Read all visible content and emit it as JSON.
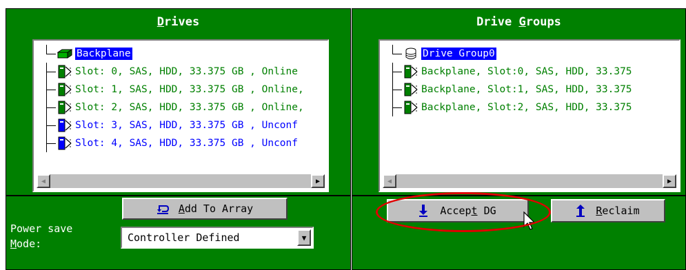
{
  "drives": {
    "title_pre": "",
    "title_u": "D",
    "title_post": "rives",
    "root": "Backplane",
    "items": [
      {
        "label": "Slot: 0, SAS, HDD, 33.375 GB , Online",
        "state": "online"
      },
      {
        "label": "Slot: 1, SAS, HDD, 33.375 GB , Online,",
        "state": "online"
      },
      {
        "label": "Slot: 2, SAS, HDD, 33.375 GB , Online,",
        "state": "online"
      },
      {
        "label": "Slot: 3, SAS, HDD, 33.375 GB , Unconf",
        "state": "unconf"
      },
      {
        "label": "Slot: 4, SAS, HDD, 33.375 GB , Unconf",
        "state": "unconf"
      }
    ],
    "add_pre": "",
    "add_u": "A",
    "add_post": "dd To Array",
    "power_line1": "Power save",
    "power_u": "M",
    "power_post": "ode:",
    "power_value": "Controller Defined"
  },
  "groups": {
    "title_pre": "Drive ",
    "title_u": "G",
    "title_post": "roups",
    "root": "Drive Group0",
    "items": [
      {
        "label": "Backplane, Slot:0, SAS, HDD, 33.375"
      },
      {
        "label": "Backplane, Slot:1, SAS, HDD, 33.375"
      },
      {
        "label": "Backplane, Slot:2, SAS, HDD, 33.375"
      }
    ],
    "accept_pre": "Accep",
    "accept_u": "t",
    "accept_post": " DG",
    "reclaim_pre": "",
    "reclaim_u": "R",
    "reclaim_post": "eclaim"
  },
  "colors": {
    "panel": "#008000",
    "selection": "#0000ff",
    "online": "#008000",
    "unconf": "#0000ff",
    "highlight": "#e00000"
  }
}
